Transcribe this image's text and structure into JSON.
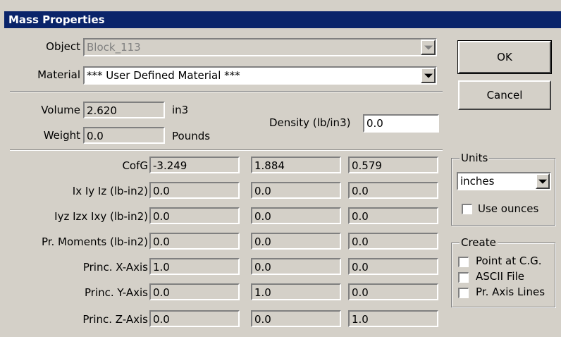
{
  "window": {
    "title": "Mass Properties"
  },
  "object": {
    "label": "Object",
    "value": "Block_113"
  },
  "material": {
    "label": "Material",
    "value": "*** User Defined Material ***"
  },
  "buttons": {
    "ok": "OK",
    "cancel": "Cancel"
  },
  "volume": {
    "label": "Volume",
    "value": "2.620",
    "unit": "in3"
  },
  "weight": {
    "label": "Weight",
    "value": "0.0",
    "unit": "Pounds"
  },
  "density": {
    "label": "Density (lb/in3)",
    "value": "0.0"
  },
  "grid": {
    "rows": [
      {
        "label": "CofG",
        "values": [
          "-3.249",
          "1.884",
          "0.579"
        ]
      },
      {
        "label": "Ix Iy Iz (lb-in2)",
        "values": [
          "0.0",
          "0.0",
          "0.0"
        ]
      },
      {
        "label": "Iyz Izx Ixy (lb-in2)",
        "values": [
          "0.0",
          "0.0",
          "0.0"
        ]
      },
      {
        "label": "Pr. Moments (lb-in2)",
        "values": [
          "0.0",
          "0.0",
          "0.0"
        ]
      },
      {
        "label": "Princ. X-Axis",
        "values": [
          "1.0",
          "0.0",
          "0.0"
        ]
      },
      {
        "label": "Princ. Y-Axis",
        "values": [
          "0.0",
          "1.0",
          "0.0"
        ]
      },
      {
        "label": "Princ. Z-Axis",
        "values": [
          "0.0",
          "0.0",
          "1.0"
        ]
      }
    ]
  },
  "units": {
    "legend": "Units",
    "selected": "inches",
    "use_ounces": "Use ounces",
    "use_ounces_checked": false
  },
  "create": {
    "legend": "Create",
    "options": [
      {
        "label": "Point at C.G.",
        "checked": false
      },
      {
        "label": "ASCII File",
        "checked": false
      },
      {
        "label": "Pr. Axis Lines",
        "checked": false
      }
    ]
  }
}
